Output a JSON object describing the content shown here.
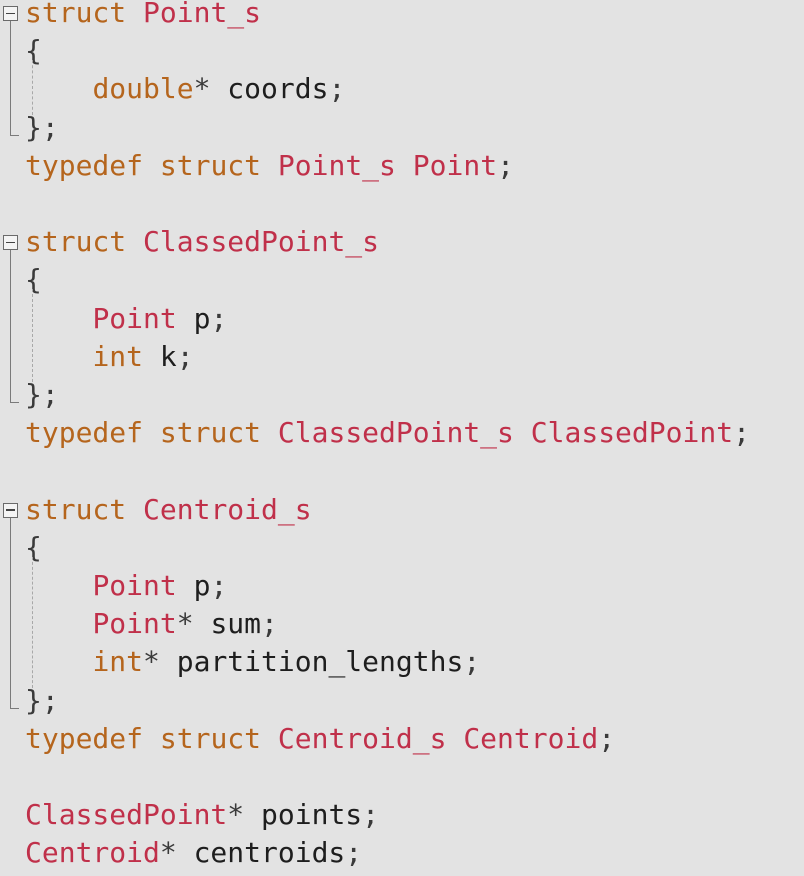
{
  "code": {
    "lines": [
      [
        {
          "t": "struct",
          "c": "kw"
        },
        {
          "t": " "
        },
        {
          "t": "Point_s",
          "c": "ty"
        }
      ],
      [
        {
          "t": "{",
          "c": "pu"
        }
      ],
      [
        {
          "t": "    "
        },
        {
          "t": "double",
          "c": "kw"
        },
        {
          "t": "*",
          "c": "pu"
        },
        {
          "t": " coords"
        },
        {
          "t": ";",
          "c": "pu"
        }
      ],
      [
        {
          "t": "};",
          "c": "pu"
        }
      ],
      [
        {
          "t": "typedef",
          "c": "kw"
        },
        {
          "t": " "
        },
        {
          "t": "struct",
          "c": "kw"
        },
        {
          "t": " "
        },
        {
          "t": "Point_s",
          "c": "ty"
        },
        {
          "t": " "
        },
        {
          "t": "Point",
          "c": "ty"
        },
        {
          "t": ";",
          "c": "pu"
        }
      ],
      [],
      [
        {
          "t": "struct",
          "c": "kw"
        },
        {
          "t": " "
        },
        {
          "t": "ClassedPoint_s",
          "c": "ty"
        }
      ],
      [
        {
          "t": "{",
          "c": "pu"
        }
      ],
      [
        {
          "t": "    "
        },
        {
          "t": "Point",
          "c": "ty"
        },
        {
          "t": " p"
        },
        {
          "t": ";",
          "c": "pu"
        }
      ],
      [
        {
          "t": "    "
        },
        {
          "t": "int",
          "c": "kw"
        },
        {
          "t": " k"
        },
        {
          "t": ";",
          "c": "pu"
        }
      ],
      [
        {
          "t": "};",
          "c": "pu"
        }
      ],
      [
        {
          "t": "typedef",
          "c": "kw"
        },
        {
          "t": " "
        },
        {
          "t": "struct",
          "c": "kw"
        },
        {
          "t": " "
        },
        {
          "t": "ClassedPoint_s",
          "c": "ty"
        },
        {
          "t": " "
        },
        {
          "t": "ClassedPoint",
          "c": "ty"
        },
        {
          "t": ";",
          "c": "pu"
        }
      ],
      [],
      [
        {
          "t": "struct",
          "c": "kw"
        },
        {
          "t": " "
        },
        {
          "t": "Centroid_s",
          "c": "ty"
        }
      ],
      [
        {
          "t": "{",
          "c": "pu"
        }
      ],
      [
        {
          "t": "    "
        },
        {
          "t": "Point",
          "c": "ty"
        },
        {
          "t": " p"
        },
        {
          "t": ";",
          "c": "pu"
        }
      ],
      [
        {
          "t": "    "
        },
        {
          "t": "Point",
          "c": "ty"
        },
        {
          "t": "*",
          "c": "pu"
        },
        {
          "t": " sum"
        },
        {
          "t": ";",
          "c": "pu"
        }
      ],
      [
        {
          "t": "    "
        },
        {
          "t": "int",
          "c": "kw"
        },
        {
          "t": "*",
          "c": "pu"
        },
        {
          "t": " partition_lengths"
        },
        {
          "t": ";",
          "c": "pu"
        }
      ],
      [
        {
          "t": "};",
          "c": "pu"
        }
      ],
      [
        {
          "t": "typedef",
          "c": "kw"
        },
        {
          "t": " "
        },
        {
          "t": "struct",
          "c": "kw"
        },
        {
          "t": " "
        },
        {
          "t": "Centroid_s",
          "c": "ty"
        },
        {
          "t": " "
        },
        {
          "t": "Centroid",
          "c": "ty"
        },
        {
          "t": ";",
          "c": "pu"
        }
      ],
      [],
      [
        {
          "t": "ClassedPoint",
          "c": "ty"
        },
        {
          "t": "*",
          "c": "pu"
        },
        {
          "t": " points"
        },
        {
          "t": ";",
          "c": "pu"
        }
      ],
      [
        {
          "t": "Centroid",
          "c": "ty"
        },
        {
          "t": "*",
          "c": "pu"
        },
        {
          "t": " centroids"
        },
        {
          "t": ";",
          "c": "pu"
        }
      ]
    ],
    "fold_blocks": [
      {
        "start": 0,
        "end": 3
      },
      {
        "start": 6,
        "end": 10
      },
      {
        "start": 13,
        "end": 18
      }
    ]
  },
  "colors": {
    "background": "#e3e3e3",
    "keyword": "#b5651d",
    "type": "#c0304a",
    "identifier": "#1e1e1e"
  }
}
